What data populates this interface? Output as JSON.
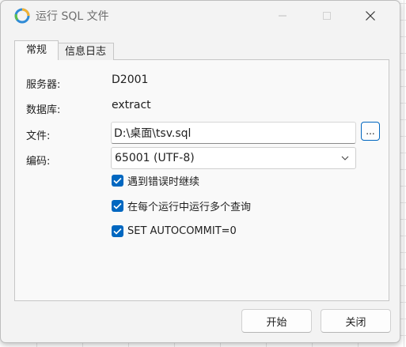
{
  "window": {
    "title": "运行 SQL 文件",
    "controls": {
      "minimize_icon": "minimize-icon",
      "maximize_icon": "maximize-icon",
      "close_icon": "close-icon"
    }
  },
  "tabs": [
    {
      "label": "常规",
      "active": true
    },
    {
      "label": "信息日志",
      "active": false
    }
  ],
  "general": {
    "server_label": "服务器:",
    "server_value": "D2001",
    "database_label": "数据库:",
    "database_value": "extract",
    "file_label": "文件:",
    "file_value": "D:\\桌面\\tsv.sql",
    "browse_label": "...",
    "encoding_label": "编码:",
    "encoding_value": "65001 (UTF-8)",
    "options": [
      {
        "label": "遇到错误时继续",
        "checked": true
      },
      {
        "label": "在每个运行中运行多个查询",
        "checked": true
      },
      {
        "label": "SET AUTOCOMMIT=0",
        "checked": true
      }
    ]
  },
  "buttons": {
    "start": "开始",
    "close": "关闭"
  },
  "colors": {
    "accent": "#0067c0",
    "window_bg": "#f3f3f3",
    "panel_bg": "#f9f9f9"
  }
}
